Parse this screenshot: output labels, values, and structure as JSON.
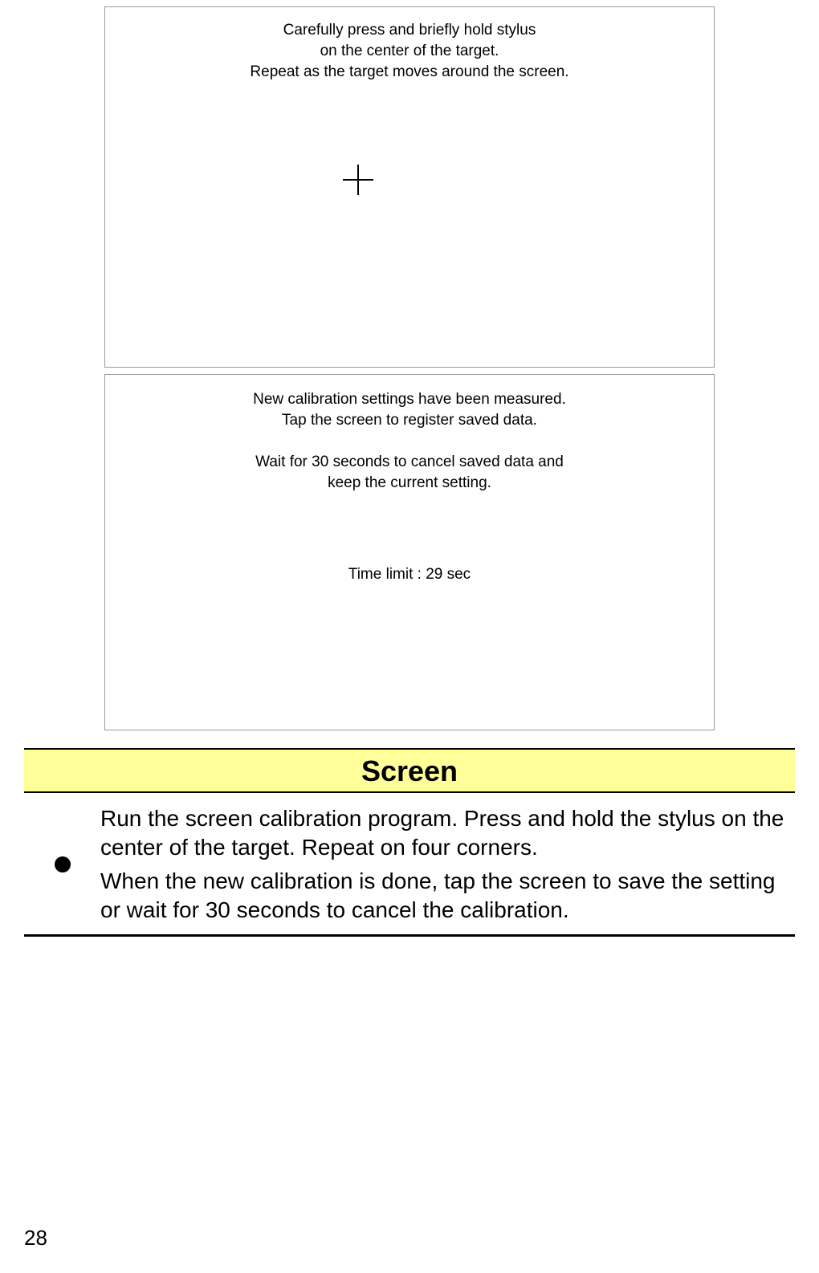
{
  "screenshot1": {
    "instruction": "Carefully press and briefly hold stylus\non the center of the target.\nRepeat as the target moves around the screen."
  },
  "screenshot2": {
    "message": "New calibration settings have been measured.\nTap the screen to register saved data.\n\nWait for 30 seconds to cancel saved data and\nkeep the current setting.",
    "timer": "Time limit : 29 sec"
  },
  "section": {
    "title": "Screen",
    "paragraph1": "Run the screen calibration program. Press and hold the stylus on the center of the target. Repeat on four corners.",
    "paragraph2": "When the new calibration is done, tap the screen to save the setting or wait for 30 seconds to cancel the calibration."
  },
  "page_number": "28"
}
